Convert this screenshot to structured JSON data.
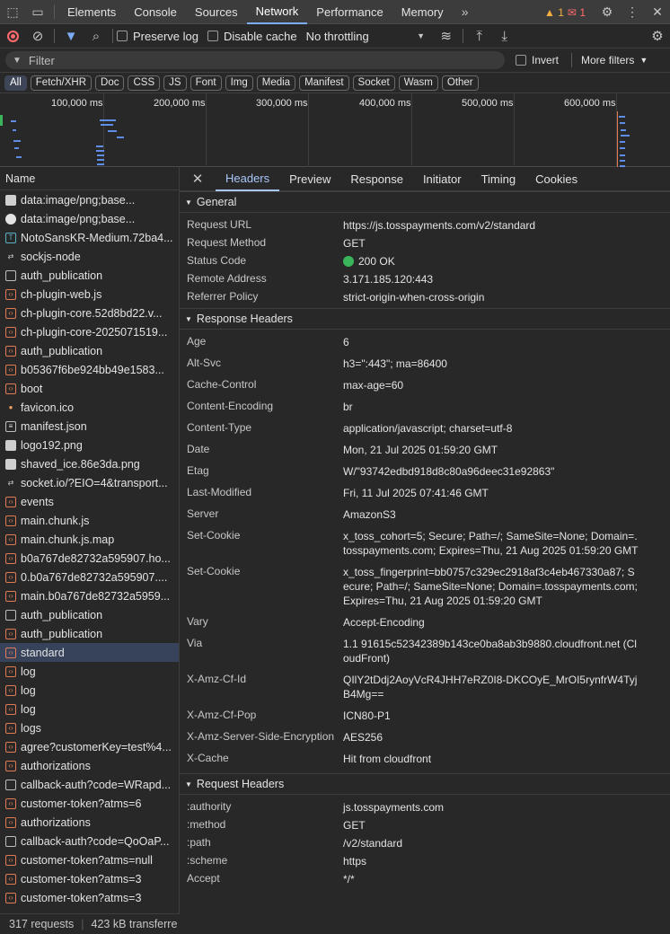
{
  "tabs": [
    "Elements",
    "Console",
    "Sources",
    "Network",
    "Performance",
    "Memory"
  ],
  "active_tab": "Network",
  "badges": {
    "warnings": "1",
    "errors": "1"
  },
  "toolbar": {
    "preserve_log": "Preserve log",
    "disable_cache": "Disable cache",
    "throttling": "No throttling"
  },
  "filter": {
    "placeholder": "Filter",
    "invert": "Invert",
    "more_filters": "More filters"
  },
  "type_filters": [
    "All",
    "Fetch/XHR",
    "Doc",
    "CSS",
    "JS",
    "Font",
    "Img",
    "Media",
    "Manifest",
    "Socket",
    "Wasm",
    "Other"
  ],
  "timeline": {
    "ticks": [
      "100,000 ms",
      "200,000 ms",
      "300,000 ms",
      "400,000 ms",
      "500,000 ms",
      "600,000 ms"
    ]
  },
  "name_header": "Name",
  "requests": [
    {
      "name": "data:image/png;base...",
      "icon": "image-icon"
    },
    {
      "name": "data:image/png;base...",
      "icon": "circle-image-icon"
    },
    {
      "name": "NotoSansKR-Medium.72ba4...",
      "icon": "font-icon"
    },
    {
      "name": "sockjs-node",
      "icon": "websocket-icon"
    },
    {
      "name": "auth_publication",
      "icon": "document-icon"
    },
    {
      "name": "ch-plugin-web.js",
      "icon": "script-icon"
    },
    {
      "name": "ch-plugin-core.52d8bd22.v...",
      "icon": "script-icon"
    },
    {
      "name": "ch-plugin-core-2025071519...",
      "icon": "script-icon"
    },
    {
      "name": "auth_publication",
      "icon": "script-icon"
    },
    {
      "name": "b05367f6be924bb49e1583...",
      "icon": "script-icon"
    },
    {
      "name": "boot",
      "icon": "script-icon"
    },
    {
      "name": "favicon.ico",
      "icon": "favicon-icon"
    },
    {
      "name": "manifest.json",
      "icon": "manifest-icon"
    },
    {
      "name": "logo192.png",
      "icon": "image-icon"
    },
    {
      "name": "shaved_ice.86e3da.png",
      "icon": "image-icon"
    },
    {
      "name": "socket.io/?EIO=4&transport...",
      "icon": "websocket-icon"
    },
    {
      "name": "events",
      "icon": "script-icon"
    },
    {
      "name": "main.chunk.js",
      "icon": "script-icon"
    },
    {
      "name": "main.chunk.js.map",
      "icon": "script-icon"
    },
    {
      "name": "b0a767de82732a595907.ho...",
      "icon": "script-icon"
    },
    {
      "name": "0.b0a767de82732a595907....",
      "icon": "script-icon"
    },
    {
      "name": "main.b0a767de82732a5959...",
      "icon": "script-icon"
    },
    {
      "name": "auth_publication",
      "icon": "document-icon"
    },
    {
      "name": "auth_publication",
      "icon": "script-icon"
    },
    {
      "name": "standard",
      "icon": "script-icon",
      "selected": true
    },
    {
      "name": "log",
      "icon": "script-icon"
    },
    {
      "name": "log",
      "icon": "script-icon"
    },
    {
      "name": "log",
      "icon": "script-icon"
    },
    {
      "name": "logs",
      "icon": "script-icon"
    },
    {
      "name": "agree?customerKey=test%4...",
      "icon": "script-icon"
    },
    {
      "name": "authorizations",
      "icon": "script-icon"
    },
    {
      "name": "callback-auth?code=WRapd...",
      "icon": "document-icon"
    },
    {
      "name": "customer-token?atms=6",
      "icon": "script-icon"
    },
    {
      "name": "authorizations",
      "icon": "script-icon"
    },
    {
      "name": "callback-auth?code=QoOaP...",
      "icon": "document-icon"
    },
    {
      "name": "customer-token?atms=null",
      "icon": "script-icon"
    },
    {
      "name": "customer-token?atms=3",
      "icon": "script-icon"
    },
    {
      "name": "customer-token?atms=3",
      "icon": "script-icon"
    }
  ],
  "footer": {
    "requests": "317 requests",
    "transferred": "423 kB transferre"
  },
  "detail_tabs": [
    "Headers",
    "Preview",
    "Response",
    "Initiator",
    "Timing",
    "Cookies"
  ],
  "active_detail_tab": "Headers",
  "general": {
    "title": "General",
    "rows": [
      {
        "k": "Request URL",
        "v": "https://js.tosspayments.com/v2/standard"
      },
      {
        "k": "Request Method",
        "v": "GET"
      },
      {
        "k": "Status Code",
        "v": "200 OK",
        "status": true
      },
      {
        "k": "Remote Address",
        "v": "3.171.185.120:443"
      },
      {
        "k": "Referrer Policy",
        "v": "strict-origin-when-cross-origin"
      }
    ]
  },
  "response_headers": {
    "title": "Response Headers",
    "rows": [
      {
        "k": "Age",
        "v": "6"
      },
      {
        "k": "Alt-Svc",
        "v": "h3=\":443\"; ma=86400"
      },
      {
        "k": "Cache-Control",
        "v": "max-age=60"
      },
      {
        "k": "Content-Encoding",
        "v": "br"
      },
      {
        "k": "Content-Type",
        "v": "application/javascript; charset=utf-8"
      },
      {
        "k": "Date",
        "v": "Mon, 21 Jul 2025 01:59:20 GMT"
      },
      {
        "k": "Etag",
        "v": "W/\"93742edbd918d8c80a96deec31e92863\""
      },
      {
        "k": "Last-Modified",
        "v": "Fri, 11 Jul 2025 07:41:46 GMT"
      },
      {
        "k": "Server",
        "v": "AmazonS3"
      },
      {
        "k": "Set-Cookie",
        "v": "x_toss_cohort=5; Secure; Path=/; SameSite=None; Domain=.tosspayments.com; Expires=Thu, 21 Aug 2025 01:59:20 GMT"
      },
      {
        "k": "Set-Cookie",
        "v": "x_toss_fingerprint=bb0757c329ec2918af3c4eb467330a87; Secure; Path=/; SameSite=None; Domain=.tosspayments.com; Expires=Thu, 21 Aug 2025 01:59:20 GMT"
      },
      {
        "k": "Vary",
        "v": "Accept-Encoding"
      },
      {
        "k": "Via",
        "v": "1.1 91615c52342389b143ce0ba8ab3b9880.cloudfront.net (CloudFront)"
      },
      {
        "k": "X-Amz-Cf-Id",
        "v": "QIlY2tDdj2AoyVcR4JHH7eRZ0I8-DKCOyE_MrOI5rynfrW4TyjB4Mg=="
      },
      {
        "k": "X-Amz-Cf-Pop",
        "v": "ICN80-P1"
      },
      {
        "k": "X-Amz-Server-Side-Encryption",
        "v": "AES256"
      },
      {
        "k": "X-Cache",
        "v": "Hit from cloudfront"
      }
    ]
  },
  "request_headers": {
    "title": "Request Headers",
    "rows": [
      {
        "k": ":authority",
        "v": "js.tosspayments.com"
      },
      {
        "k": ":method",
        "v": "GET"
      },
      {
        "k": ":path",
        "v": "/v2/standard"
      },
      {
        "k": ":scheme",
        "v": "https"
      },
      {
        "k": "Accept",
        "v": "*/*"
      }
    ]
  }
}
